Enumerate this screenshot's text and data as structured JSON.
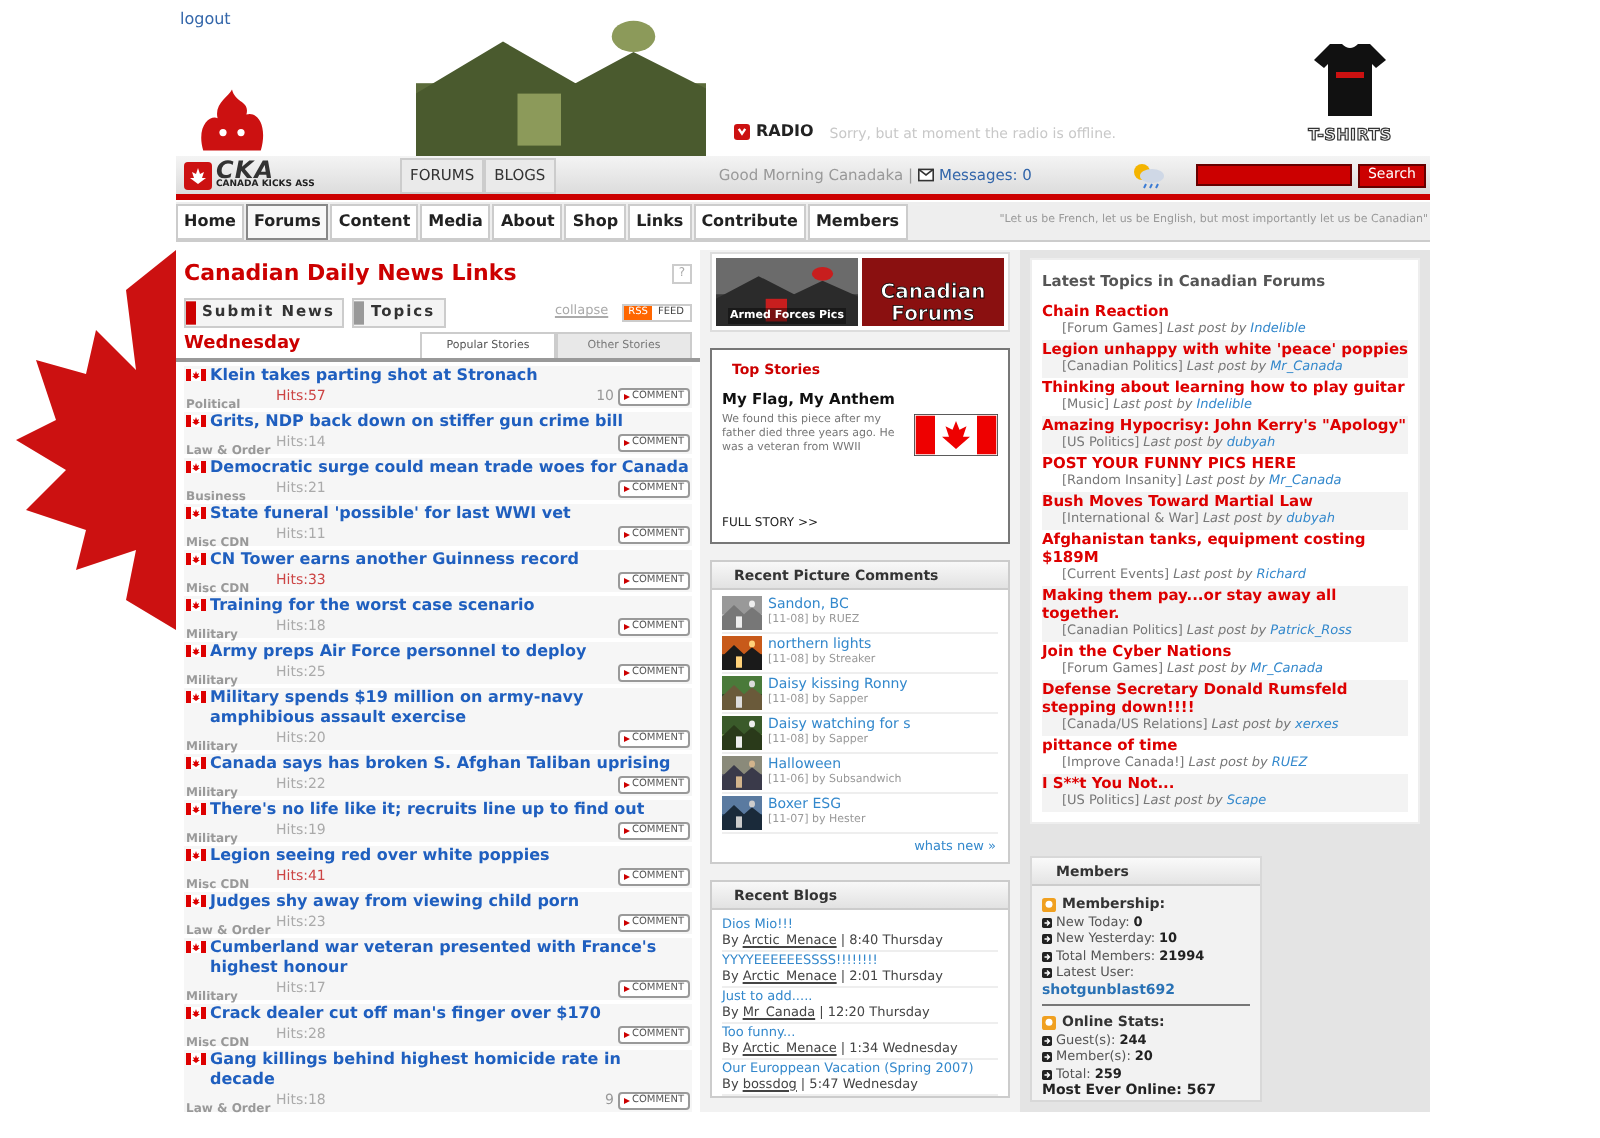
{
  "header": {
    "logout": "logout",
    "radio_label": "RADIO",
    "radio_message": "Sorry, but at moment the radio is offline.",
    "tshirts_label": "T-SHIRTS",
    "logo": "CKA",
    "logo_tagline": "CANADA KICKS ASS",
    "tabs": [
      {
        "label": "FORUMS",
        "selected": false
      },
      {
        "label": "BLOGS",
        "selected": false
      }
    ],
    "greeting": "Good Morning Canadaka |",
    "messages": "Messages: 0",
    "search_button": "Search"
  },
  "nav": {
    "items": [
      {
        "label": "Home",
        "selected": false
      },
      {
        "label": "Forums",
        "selected": true
      },
      {
        "label": "Content",
        "selected": false
      },
      {
        "label": "Media",
        "selected": false
      },
      {
        "label": "About",
        "selected": false
      },
      {
        "label": "Shop",
        "selected": false
      },
      {
        "label": "Links",
        "selected": false
      },
      {
        "label": "Contribute",
        "selected": false
      },
      {
        "label": "Members",
        "selected": false
      }
    ],
    "quote": "\"Let us be French, let us be English, but most importantly let us be Canadian\""
  },
  "news": {
    "title": "Canadian Daily News Links",
    "help": "?",
    "submit": "Submit News",
    "topics": "Topics",
    "collapse": "collapse",
    "rss": "RSS",
    "feed": "FEED",
    "day": "Wednesday",
    "tabs": [
      {
        "label": "Popular Stories",
        "selected": true
      },
      {
        "label": "Other Stories",
        "selected": false
      }
    ],
    "items": [
      {
        "headline": "Klein takes parting shot at Stronach",
        "category": "Political",
        "hits": "Hits:57",
        "hot": true,
        "comments": "10",
        "button": "COMMENT"
      },
      {
        "headline": "Grits, NDP back down on stiffer gun crime bill",
        "category": "Law & Order",
        "hits": "Hits:14",
        "hot": false,
        "button": "COMMENT"
      },
      {
        "headline": "Democratic surge could mean trade woes for Canada",
        "category": "Business",
        "hits": "Hits:21",
        "hot": false,
        "button": "COMMENT"
      },
      {
        "headline": "State funeral 'possible' for last WWI vet",
        "category": "Misc CDN",
        "hits": "Hits:11",
        "hot": false,
        "button": "COMMENT"
      },
      {
        "headline": "CN Tower earns another Guinness record",
        "category": "Misc CDN",
        "hits": "Hits:33",
        "hot": true,
        "button": "COMMENT"
      },
      {
        "headline": "Training for the worst case scenario",
        "category": "Military",
        "hits": "Hits:18",
        "hot": false,
        "button": "COMMENT"
      },
      {
        "headline": "Army preps Air Force personnel to deploy",
        "category": "Military",
        "hits": "Hits:25",
        "hot": false,
        "button": "COMMENT"
      },
      {
        "headline": "Military spends $19 million on army-navy amphibious assault exercise",
        "category": "Military",
        "hits": "Hits:20",
        "hot": false,
        "button": "COMMENT"
      },
      {
        "headline": "Canada says has broken S. Afghan Taliban uprising",
        "category": "Military",
        "hits": "Hits:22",
        "hot": false,
        "button": "COMMENT"
      },
      {
        "headline": "There's no life like it; recruits line up to find out",
        "category": "Military",
        "hits": "Hits:19",
        "hot": false,
        "button": "COMMENT"
      },
      {
        "headline": "Legion seeing red over white poppies",
        "category": "Misc CDN",
        "hits": "Hits:41",
        "hot": true,
        "button": "COMMENT"
      },
      {
        "headline": "Judges shy away from viewing child porn",
        "category": "Law & Order",
        "hits": "Hits:23",
        "hot": false,
        "button": "COMMENT"
      },
      {
        "headline": "Cumberland war veteran presented with France's highest honour",
        "category": "Military",
        "hits": "Hits:17",
        "hot": false,
        "button": "COMMENT"
      },
      {
        "headline": "Crack dealer cut off man's finger over $170",
        "category": "Misc CDN",
        "hits": "Hits:28",
        "hot": false,
        "button": "COMMENT"
      },
      {
        "headline": "Gang killings behind highest homicide rate in decade",
        "category": "Law & Order",
        "hits": "Hits:18",
        "hot": false,
        "comments": "9",
        "button": "COMMENT"
      }
    ]
  },
  "banners": [
    {
      "label": "Armed Forces Pics"
    },
    {
      "label": "Canadian Forums",
      "kind": "plain"
    }
  ],
  "top_stories": {
    "heading": "Top Stories",
    "title": "My Flag, My Anthem",
    "text": "We found this piece after my father died three years ago.  He was a veteran from WWII",
    "more": "FULL STORY >>"
  },
  "picture_comments": {
    "heading": "Recent Picture Comments",
    "items": [
      {
        "title": "Sandon, BC",
        "meta": "[11-08] by RUEZ"
      },
      {
        "title": "northern lights",
        "meta": "[11-08] by Streaker"
      },
      {
        "title": "Daisy kissing Ronny",
        "meta": "[11-08] by Sapper"
      },
      {
        "title": "Daisy watching for s",
        "meta": "[11-08] by Sapper"
      },
      {
        "title": "Halloween",
        "meta": "[11-06] by Subsandwich"
      },
      {
        "title": "Boxer ESG",
        "meta": "[11-07] by Hester"
      }
    ],
    "more": "whats new »"
  },
  "blogs": {
    "heading": "Recent Blogs",
    "items": [
      {
        "title": "Dios Mio!!!",
        "by": "By",
        "author": "Arctic_Menace",
        "time": "| 8:40 Thursday"
      },
      {
        "title": "YYYYEEEEEESSSS!!!!!!!!",
        "by": "By",
        "author": "Arctic_Menace",
        "time": "| 2:01 Thursday"
      },
      {
        "title": "Just to add.....",
        "by": "By",
        "author": "Mr_Canada",
        "time": "| 12:20 Thursday"
      },
      {
        "title": "Too funny...",
        "by": "By",
        "author": "Arctic_Menace",
        "time": "| 1:34 Wednesday"
      },
      {
        "title": "Our Europpean Vacation (Spring 2007)",
        "by": "By",
        "author": "bossdog",
        "time": "| 5:47 Wednesday"
      }
    ]
  },
  "topics": {
    "heading": "Latest Topics in Canadian Forums",
    "items": [
      {
        "title": "Chain Reaction",
        "forum": "[Forum Games]",
        "by": "Last post by",
        "user": "Indelible"
      },
      {
        "title": "Legion unhappy with white 'peace' poppies",
        "forum": "[Canadian Politics]",
        "by": "Last post by",
        "user": "Mr_Canada"
      },
      {
        "title": "Thinking about learning how to play guitar",
        "forum": "[Music]",
        "by": "Last post by",
        "user": "Indelible"
      },
      {
        "title": "Amazing Hypocrisy: John Kerry's \"Apology\"",
        "forum": "[US Politics]",
        "by": "Last post by",
        "user": "dubyah"
      },
      {
        "title": "POST YOUR FUNNY PICS HERE",
        "forum": "[Random Insanity]",
        "by": "Last post by",
        "user": "Mr_Canada"
      },
      {
        "title": "Bush Moves Toward Martial Law",
        "forum": "[International & War]",
        "by": "Last post by",
        "user": "dubyah"
      },
      {
        "title": "Afghanistan tanks, equipment costing $189M",
        "forum": "[Current Events]",
        "by": "Last post by",
        "user": "Richard"
      },
      {
        "title": "Making them pay...or stay away all together.",
        "forum": "[Canadian Politics]",
        "by": "Last post by",
        "user": "Patrick_Ross"
      },
      {
        "title": "Join the Cyber Nations",
        "forum": "[Forum Games]",
        "by": "Last post by",
        "user": "Mr_Canada"
      },
      {
        "title": "Defense Secretary Donald Rumsfeld stepping down!!!!",
        "forum": "[Canada/US Relations]",
        "by": "Last post by",
        "user": "xerxes"
      },
      {
        "title": "pittance of time",
        "forum": "[Improve Canada!]",
        "by": "Last post by",
        "user": "RUEZ"
      },
      {
        "title": "I S**t You Not...",
        "forum": "[US Politics]",
        "by": "Last post by",
        "user": "Scape"
      }
    ]
  },
  "members": {
    "heading": "Members",
    "sections": [
      {
        "title": "Membership:",
        "stats": [
          {
            "label": "New Today:",
            "value": "0"
          },
          {
            "label": "New Yesterday:",
            "value": "10"
          },
          {
            "label": "Total Members:",
            "value": "21994"
          },
          {
            "label": "Latest User:"
          }
        ],
        "latest_user": "shotgunblast692"
      },
      {
        "title": "Online Stats:",
        "stats": [
          {
            "label": "Guest(s):",
            "value": "244"
          },
          {
            "label": "Member(s):",
            "value": "20"
          },
          {
            "label": "Total:",
            "value": "259"
          }
        ]
      }
    ],
    "most_ever": "Most Ever Online: 567"
  }
}
